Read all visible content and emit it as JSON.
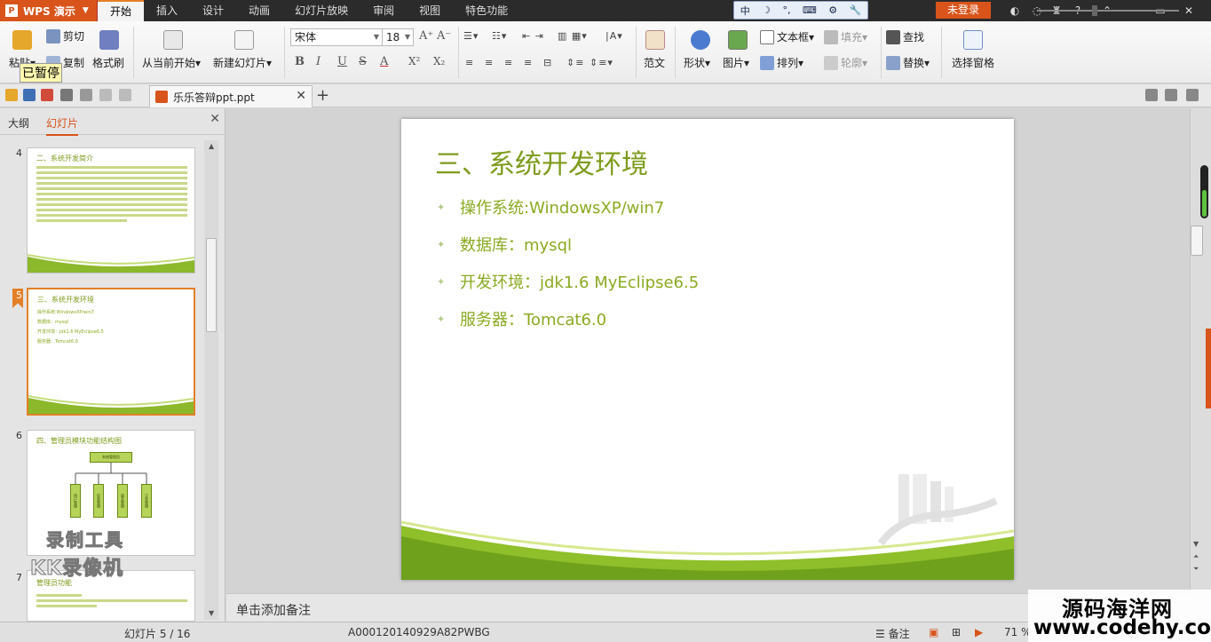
{
  "app": {
    "name": "WPS 演示",
    "logo_letter": "P"
  },
  "menu": {
    "tabs": [
      "开始",
      "插入",
      "设计",
      "动画",
      "幻灯片放映",
      "审阅",
      "视图",
      "特色功能"
    ],
    "login_label": "未登录",
    "ime": [
      "中",
      "☽",
      "°,",
      "⌨",
      "⚙",
      "🔧"
    ],
    "win_controls": [
      "─",
      "▭",
      "✕"
    ]
  },
  "ribbon": {
    "paste_label": "粘贴",
    "cut_label": "剪切",
    "copy_label": "复制",
    "format_painter_label": "格式刷",
    "from_current_label": "从当前开始",
    "new_slide_label": "新建幻灯片",
    "font_name": "宋体",
    "font_size": "18",
    "bold": "B",
    "italic": "I",
    "underline": "U",
    "strike": "S",
    "font_color": "A",
    "superscript": "X²",
    "subscript": "X₂",
    "template_label": "范文",
    "shape_label": "形状",
    "picture_label": "图片",
    "textbox_label": "文本框",
    "arrange_label": "排列",
    "fill_label": "填充",
    "outline_label": "轮廓",
    "find_label": "查找",
    "replace_label": "替换",
    "select_pane_label": "选择窗格",
    "paused_label": "已暂停"
  },
  "quickbar": {
    "doc_tab_name": "乐乐答辩ppt.ppt",
    "close": "✕",
    "new_tab": "+"
  },
  "left_panel": {
    "tab_outline": "大纲",
    "tab_slides": "幻灯片",
    "close": "✕",
    "thumbs": [
      {
        "num": "4",
        "title": "二、系统开发简介"
      },
      {
        "num": "5",
        "title": "三、系统开发环境",
        "bullets": [
          "操作系统:WindowsXP/win7",
          "数据库：mysql",
          "开发环境：jdk1.6  MyEclipse6.5",
          "服务器：Tomcat6.0"
        ]
      },
      {
        "num": "6",
        "title": "四、管理员模块功能结构图",
        "org_root": "系统管理员",
        "org_children": [
          "用户管理",
          "信息管理",
          "留言管理",
          "订单管理"
        ]
      },
      {
        "num": "7",
        "title": "管理员功能"
      }
    ],
    "watermark_line1": "录制工具",
    "watermark_line2": "KK录像机"
  },
  "slide": {
    "title": "三、系统开发环境",
    "bullets": [
      "操作系统:WindowsXP/win7",
      "数据库：mysql",
      "开发环境：jdk1.6  MyEclipse6.5",
      "服务器：Tomcat6.0"
    ],
    "accent_color": "#7d9b1b"
  },
  "notes": {
    "placeholder": "单击添加备注"
  },
  "statusbar": {
    "slide_counter": "幻灯片 5 / 16",
    "doc_code": "A000120140929A82PWBG",
    "notes_label": "备注",
    "zoom": "71 %"
  },
  "overlay": {
    "site_name": "源码海洋网",
    "site_url": "www.codehy.com"
  }
}
